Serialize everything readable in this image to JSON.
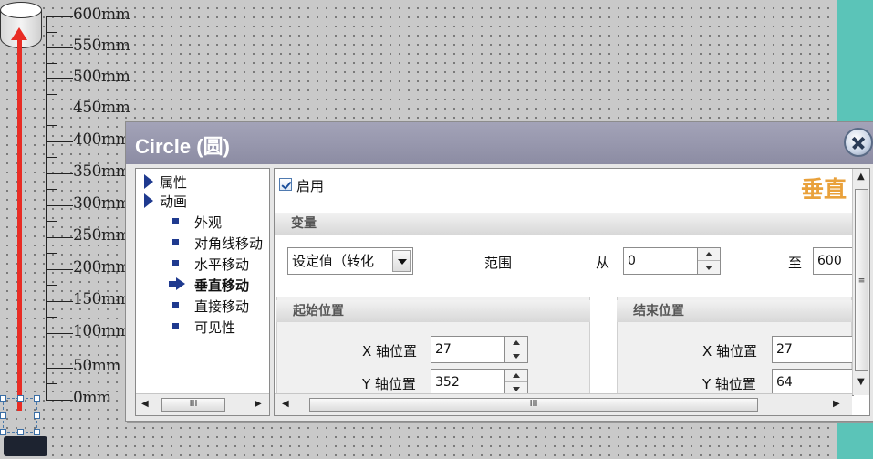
{
  "canvas": {
    "ruler_labels": [
      "600mm",
      "550mm",
      "500mm",
      "450mm",
      "400mm",
      "350mm",
      "300mm",
      "250mm",
      "200mm",
      "150mm",
      "100mm",
      "50mm",
      "0mm"
    ],
    "accent_color": "#e82c24",
    "strip_color": "#5bc4b8"
  },
  "dialog": {
    "title": "Circle (圆)",
    "close_icon": "close-icon"
  },
  "tree": {
    "items": [
      {
        "label": "属性",
        "kind": "group"
      },
      {
        "label": "动画",
        "kind": "group"
      },
      {
        "label": "外观",
        "kind": "leaf"
      },
      {
        "label": "对角线移动",
        "kind": "leaf"
      },
      {
        "label": "水平移动",
        "kind": "leaf"
      },
      {
        "label": "垂直移动",
        "kind": "selected"
      },
      {
        "label": "直接移动",
        "kind": "leaf"
      },
      {
        "label": "可见性",
        "kind": "leaf"
      }
    ],
    "scroll_thumb": "III"
  },
  "content": {
    "enable_label": "启用",
    "heading": "垂直",
    "variable_section": "变量",
    "conversion_select": "设定值（转化",
    "range_label": "范围",
    "from_label": "从",
    "from_value": "0",
    "to_label": "至",
    "to_value": "600",
    "start_section": "起始位置",
    "end_section": "结束位置",
    "start_x_label": "X 轴位置",
    "start_x_value": "27",
    "start_y_label": "Y 轴位置",
    "start_y_value": "352",
    "end_x_label": "X 轴位置",
    "end_x_value": "27",
    "end_y_label": "Y 轴位置",
    "end_y_value": "64",
    "scroll_thumb": "III",
    "vscroll_thumb": "≡"
  }
}
